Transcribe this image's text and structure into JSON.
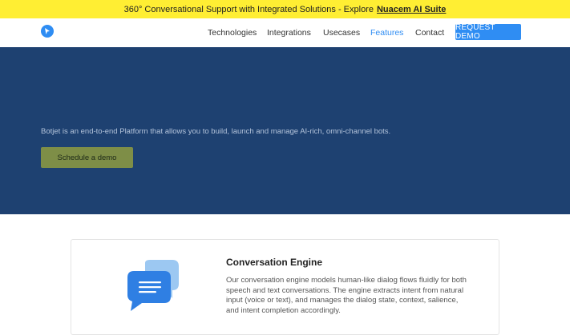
{
  "announcement": {
    "text": "360° Conversational Support with Integrated Solutions - Explore",
    "link_label": "Nuacem AI Suite"
  },
  "nav": {
    "logo_icon": "bot-arrow-logo-icon",
    "links": [
      {
        "label": "Technologies"
      },
      {
        "label": "Integrations"
      },
      {
        "label": "Usecases"
      },
      {
        "label": "Features",
        "active": true
      },
      {
        "label": "Contact"
      }
    ],
    "cta_label": "REQUEST DEMO"
  },
  "hero": {
    "tagline": "Botjet is an end-to-end Platform that allows you to build, launch and manage AI-rich, omni-channel bots.",
    "button_label": "Schedule a demo"
  },
  "feature": {
    "icon": "chat-bubbles-icon",
    "title": "Conversation Engine",
    "description": "Our conversation engine models human-like dialog flows fluidly for both speech and text conversations. The engine extracts intent from natural input (voice or text), and manages the dialog state, context, salience, and intent completion accordingly."
  },
  "colors": {
    "announce_bg": "#ffee33",
    "accent": "#2f8df3",
    "hero_bg": "#1e4171",
    "hero_button": "#7e8e47"
  }
}
